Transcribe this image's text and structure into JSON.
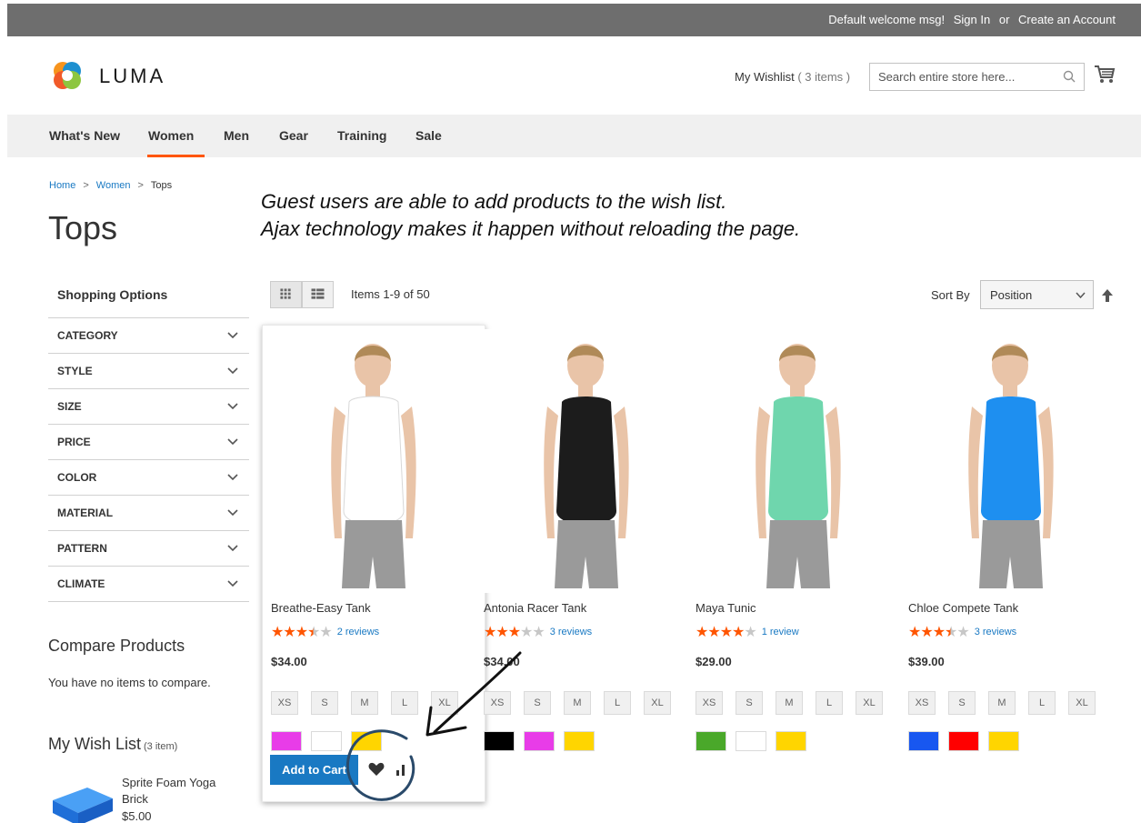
{
  "topbar": {
    "welcome": "Default welcome msg!",
    "sign_in": "Sign In",
    "or": "or",
    "create_account": "Create an Account"
  },
  "header": {
    "logo_text": "LUMA",
    "wishlist_label": "My Wishlist",
    "wishlist_count": "( 3 items )",
    "search_placeholder": "Search entire store here...",
    "search_icon": "search-icon",
    "cart_icon": "cart-icon"
  },
  "nav": {
    "items": [
      "What's New",
      "Women",
      "Men",
      "Gear",
      "Training",
      "Sale"
    ],
    "active": "Women",
    "accent_color": "#ff5501"
  },
  "breadcrumb": [
    "Home",
    "Women",
    "Tops"
  ],
  "page_title": "Tops",
  "annotation": {
    "line1": "Guest users are able to add products to the wish list.",
    "line2": "Ajax technology makes it happen without reloading the page."
  },
  "sidebar": {
    "title": "Shopping Options",
    "filters": [
      "CATEGORY",
      "STYLE",
      "SIZE",
      "PRICE",
      "COLOR",
      "MATERIAL",
      "PATTERN",
      "CLIMATE"
    ],
    "compare_title": "Compare Products",
    "compare_empty": "You have no items to compare.",
    "wishlist_title": "My Wish List",
    "wishlist_count": "(3 item)",
    "wishlist_item_name": "Sprite Foam Yoga Brick",
    "wishlist_item_price": "$5.00"
  },
  "toolbar": {
    "grid_icon": "grid-view-icon",
    "list_icon": "list-view-icon",
    "items_count": "Items 1-9 of 50",
    "sort_label": "Sort By",
    "sort_value": "Position",
    "sort_direction_icon": "arrow-up-icon"
  },
  "products": [
    {
      "name": "Breathe-Easy Tank",
      "rating": 3.5,
      "reviews": "2 reviews",
      "price": "$34.00",
      "sizes": [
        "XS",
        "S",
        "M",
        "L",
        "XL"
      ],
      "swatches": [
        "#e83ce8",
        "#ffffff",
        "#ffd500"
      ],
      "shirt_color": "#ffffff",
      "hovered": true
    },
    {
      "name": "Antonia Racer Tank",
      "rating": 3,
      "reviews": "3 reviews",
      "price": "$34.00",
      "sizes": [
        "XS",
        "S",
        "M",
        "L",
        "XL"
      ],
      "swatches": [
        "#000000",
        "#e83ce8",
        "#ffd500"
      ],
      "shirt_color": "#1c1c1c"
    },
    {
      "name": "Maya Tunic",
      "rating": 4,
      "reviews": "1 review",
      "price": "$29.00",
      "sizes": [
        "XS",
        "S",
        "M",
        "L",
        "XL"
      ],
      "swatches": [
        "#4aa82a",
        "#ffffff",
        "#ffd500"
      ],
      "shirt_color": "#6fd6ad"
    },
    {
      "name": "Chloe Compete Tank",
      "rating": 3.5,
      "reviews": "3 reviews",
      "price": "$39.00",
      "sizes": [
        "XS",
        "S",
        "M",
        "L",
        "XL"
      ],
      "swatches": [
        "#1857f0",
        "#ff0000",
        "#ffd500"
      ],
      "shirt_color": "#1e8ff0"
    }
  ],
  "card_actions": {
    "add_to_cart": "Add to Cart",
    "wishlist_icon": "heart-icon",
    "compare_icon": "compare-icon"
  },
  "colors": {
    "link": "#1979c3",
    "star": "#ff5501",
    "star_empty": "#c7c7c7",
    "topbar": "#6e6e6e"
  }
}
